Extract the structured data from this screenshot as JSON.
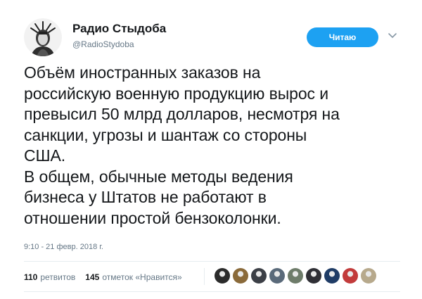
{
  "author": {
    "display_name": "Радио Стыдоба",
    "handle": "@RadioStydoba"
  },
  "follow_button": {
    "label": "Читаю"
  },
  "tweet": {
    "text": "Объём иностранных заказов на\nроссийскую военную продукцию вырос и\nпревысил 50 млрд долларов, несмотря на\nсанкции, угрозы и шантаж со стороны\nСША.\nВ общем, обычные методы ведения\nбизнеса у Штатов не работают в\nотношении простой бензоколонки.",
    "timestamp": "9:10 - 21 февр. 2018 г."
  },
  "stats": {
    "retweets_count": "110",
    "retweets_label": "ретвитов",
    "likes_count": "145",
    "likes_label": "отметок «Нравится»"
  },
  "likers": [
    {
      "name": "liker-avatar-1",
      "color": "#2b2b2b"
    },
    {
      "name": "liker-avatar-2",
      "color": "#8a6a3a"
    },
    {
      "name": "liker-avatar-3",
      "color": "#3c3f46"
    },
    {
      "name": "liker-avatar-4",
      "color": "#5a6a7a"
    },
    {
      "name": "liker-avatar-5",
      "color": "#6e7c6a"
    },
    {
      "name": "liker-avatar-6",
      "color": "#2f2f35"
    },
    {
      "name": "liker-avatar-7",
      "color": "#1f3c66"
    },
    {
      "name": "liker-avatar-8",
      "color": "#c23b3b"
    },
    {
      "name": "liker-avatar-9",
      "color": "#b7a98c"
    }
  ],
  "colors": {
    "accent": "#1da1f2",
    "secondary_text": "#657786",
    "primary_text": "#14171a",
    "divider": "#e6ecf0"
  }
}
